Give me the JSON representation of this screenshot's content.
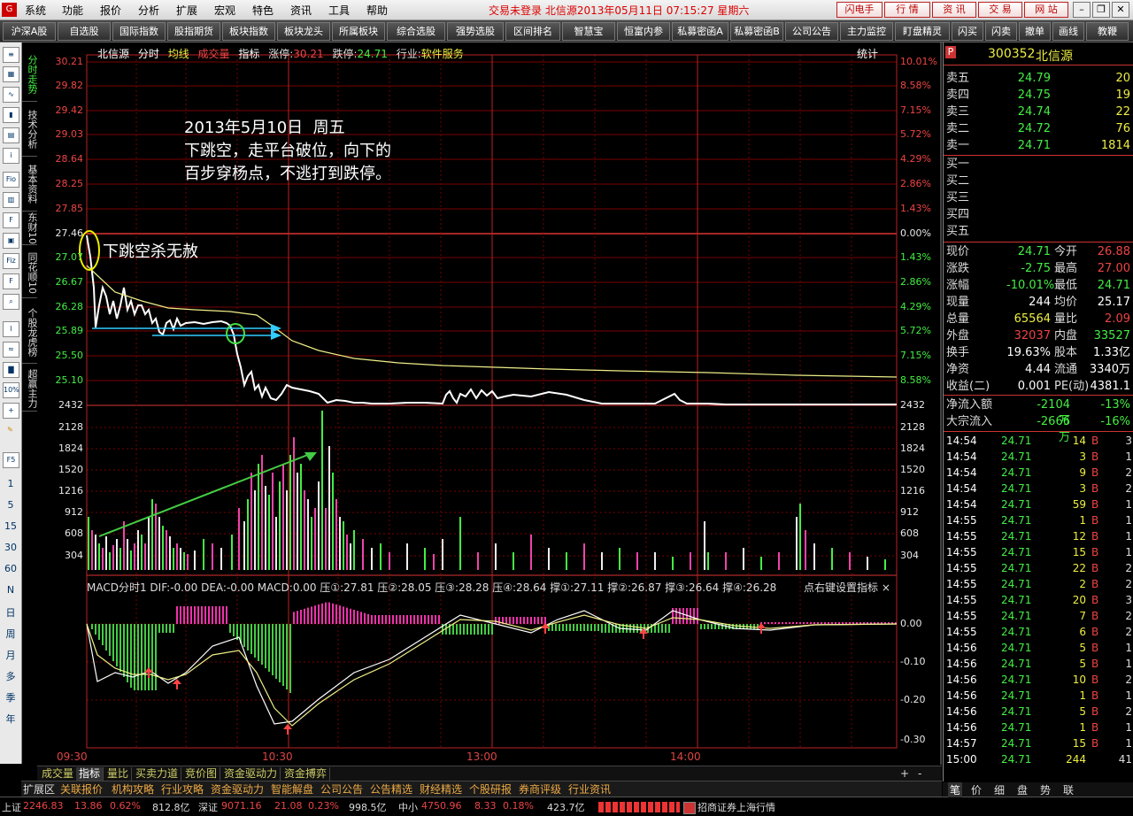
{
  "menubar": {
    "items": [
      "系统",
      "功能",
      "报价",
      "分析",
      "扩展",
      "宏观",
      "特色",
      "资讯",
      "工具",
      "帮助"
    ],
    "status": "交易未登录  北信源2013年05月11日 07:15:27 星期六",
    "buttons": [
      "闪电手",
      "行  情",
      "资  讯",
      "交  易",
      "网  站"
    ]
  },
  "toolbar": {
    "items": [
      "沪深A股",
      "自选股",
      "国际指数",
      "股指期货",
      "板块指数",
      "板块龙头",
      "所属板块",
      "综合选股",
      "强势选股",
      "区间排名",
      "智慧宝",
      "恒富内参",
      "私募密函A",
      "私募密函B",
      "公司公告",
      "主力监控",
      "盯盘精灵",
      "闪买",
      "闪卖",
      "撤单",
      "画线",
      "教鞭"
    ]
  },
  "left_panel": {
    "numbers": [
      "1",
      "5",
      "15",
      "30",
      "60",
      "N",
      "日",
      "周",
      "月",
      "多",
      "季",
      "年"
    ]
  },
  "vtabs": [
    "分时走势",
    "技术分析",
    "基本资料",
    "东财10",
    "同花顺10",
    "个股龙虎榜",
    "超赢主力"
  ],
  "chart": {
    "header": {
      "name": "北信源",
      "items": [
        "分时",
        "均线",
        "成交量",
        "指标"
      ],
      "limit_up_label": "涨停:",
      "limit_up": "30.21",
      "limit_down_label": "跌停:",
      "limit_down": "24.71",
      "industry_label": "行业:",
      "industry": "软件服务",
      "stat": "统计"
    },
    "annotation_title": "2013年5月10日  周五\n下跳空，走平台破位，向下的\n百步穿杨点，不逃打到跌停。",
    "annotation_gap": "下跳空杀无赦",
    "price_labels": [
      "30.21",
      "29.82",
      "29.42",
      "29.03",
      "28.64",
      "28.25",
      "27.85",
      "27.46",
      "27.07",
      "26.67",
      "26.28",
      "25.89",
      "25.50",
      "25.10",
      "2432"
    ],
    "pct_labels": [
      "10.01%",
      "8.58%",
      "7.15%",
      "5.72%",
      "4.29%",
      "2.86%",
      "1.43%",
      "0.00%",
      "1.43%",
      "2.86%",
      "4.29%",
      "5.72%",
      "7.15%",
      "8.58%",
      "2432"
    ],
    "vol_labels": [
      "2128",
      "1824",
      "1520",
      "1216",
      "912",
      "608",
      "304"
    ],
    "macd_labels": [
      "0.00",
      "-0.10",
      "-0.20",
      "-0.30"
    ],
    "time_labels": [
      "09:30",
      "10:30",
      "13:00",
      "14:00"
    ],
    "macd_header": "MACD分时1  DIF:-0.00  DEA:-0.00  MACD:0.00  压①:27.81  压②:28.05  压③:28.28  压④:28.64  撑①:27.11  撑②:26.87  撑③:26.64  撑④:26.28",
    "macd_tip": "点右键设置指标",
    "colors": {
      "up": "#ff3a3a",
      "down": "#44ff44",
      "price": "#ffffff",
      "avg": "#ffff88",
      "grid": "#7a0000"
    }
  },
  "bottom_tabs": [
    "成交量",
    "指标",
    "量比",
    "买卖力道",
    "竞价图",
    "资金驱动力",
    "资金搏弈"
  ],
  "nav_tabs": [
    "扩展区",
    "关联报价",
    "机构攻略",
    "行业攻略",
    "资金驱动力",
    "智能解盘",
    "公司公告",
    "公告精选",
    "财经精选",
    "个股研报",
    "券商评级",
    "行业资讯"
  ],
  "statusbar": {
    "sh_label": "上证",
    "sh": "2246.83",
    "sh_chg": "13.86",
    "sh_pct": "0.62%",
    "sh_amt": "812.8亿",
    "sz_label": "深证",
    "sz": "9071.16",
    "sz_chg": "21.08",
    "sz_pct": "0.23%",
    "sz_amt": "998.5亿",
    "zx_label": "中小",
    "zx": "4750.96",
    "zx_chg": "8.33",
    "zx_pct": "0.18%",
    "zx_amt": "423.7亿",
    "broker": "招商证券上海行情"
  },
  "quote": {
    "code": "300352",
    "name": "北信源",
    "sell": [
      {
        "label": "卖五",
        "price": "24.79",
        "vol": "20"
      },
      {
        "label": "卖四",
        "price": "24.75",
        "vol": "19"
      },
      {
        "label": "卖三",
        "price": "24.74",
        "vol": "22"
      },
      {
        "label": "卖二",
        "price": "24.72",
        "vol": "76"
      },
      {
        "label": "卖一",
        "price": "24.71",
        "vol": "1814"
      }
    ],
    "buy": [
      "买一",
      "买二",
      "买三",
      "买四",
      "买五"
    ],
    "stats": [
      {
        "l1": "现价",
        "v1": "24.71",
        "l2": "今开",
        "v2": "26.88"
      },
      {
        "l1": "涨跌",
        "v1": "-2.75",
        "l2": "最高",
        "v2": "27.00"
      },
      {
        "l1": "涨幅",
        "v1": "-10.01%",
        "l2": "最低",
        "v2": "24.71"
      },
      {
        "l1": "现量",
        "v1": "244",
        "l2": "均价",
        "v2": "25.17"
      },
      {
        "l1": "总量",
        "v1": "65564",
        "l2": "量比",
        "v2": "2.09"
      },
      {
        "l1": "外盘",
        "v1": "32037",
        "l2": "内盘",
        "v2": "33527"
      },
      {
        "l1": "换手",
        "v1": "19.63%",
        "l2": "股本",
        "v2": "1.33亿"
      },
      {
        "l1": "净资",
        "v1": "4.44",
        "l2": "流通",
        "v2": "3340万"
      },
      {
        "l1": "收益(二)",
        "v1": "0.001",
        "l2": "PE(动)",
        "v2": "4381.1"
      }
    ],
    "flows": [
      {
        "label": "净流入额",
        "val": "-2104万",
        "pct": "-13%"
      },
      {
        "label": "大宗流入",
        "val": "-2666万",
        "pct": "-16%"
      }
    ],
    "ticks": [
      [
        "14:54",
        "24.71",
        "14",
        "B",
        "3"
      ],
      [
        "14:54",
        "24.71",
        "3",
        "B",
        "1"
      ],
      [
        "14:54",
        "24.71",
        "9",
        "B",
        "2"
      ],
      [
        "14:54",
        "24.71",
        "3",
        "B",
        "2"
      ],
      [
        "14:54",
        "24.71",
        "59",
        "B",
        "1"
      ],
      [
        "14:55",
        "24.71",
        "1",
        "B",
        "1"
      ],
      [
        "14:55",
        "24.71",
        "12",
        "B",
        "1"
      ],
      [
        "14:55",
        "24.71",
        "15",
        "B",
        "1"
      ],
      [
        "14:55",
        "24.71",
        "22",
        "B",
        "2"
      ],
      [
        "14:55",
        "24.71",
        "2",
        "B",
        "2"
      ],
      [
        "14:55",
        "24.71",
        "20",
        "B",
        "3"
      ],
      [
        "14:55",
        "24.71",
        "7",
        "B",
        "2"
      ],
      [
        "14:55",
        "24.71",
        "6",
        "B",
        "2"
      ],
      [
        "14:56",
        "24.71",
        "5",
        "B",
        "1"
      ],
      [
        "14:56",
        "24.71",
        "5",
        "B",
        "1"
      ],
      [
        "14:56",
        "24.71",
        "10",
        "B",
        "2"
      ],
      [
        "14:56",
        "24.71",
        "1",
        "B",
        "1"
      ],
      [
        "14:56",
        "24.71",
        "5",
        "B",
        "2"
      ],
      [
        "14:56",
        "24.71",
        "1",
        "B",
        "1"
      ],
      [
        "14:57",
        "24.71",
        "15",
        "B",
        "1"
      ],
      [
        "15:00",
        "24.71",
        "244",
        "",
        "41"
      ]
    ],
    "bottom": [
      "笔",
      "价",
      "细",
      "盘",
      "势",
      "联"
    ]
  }
}
